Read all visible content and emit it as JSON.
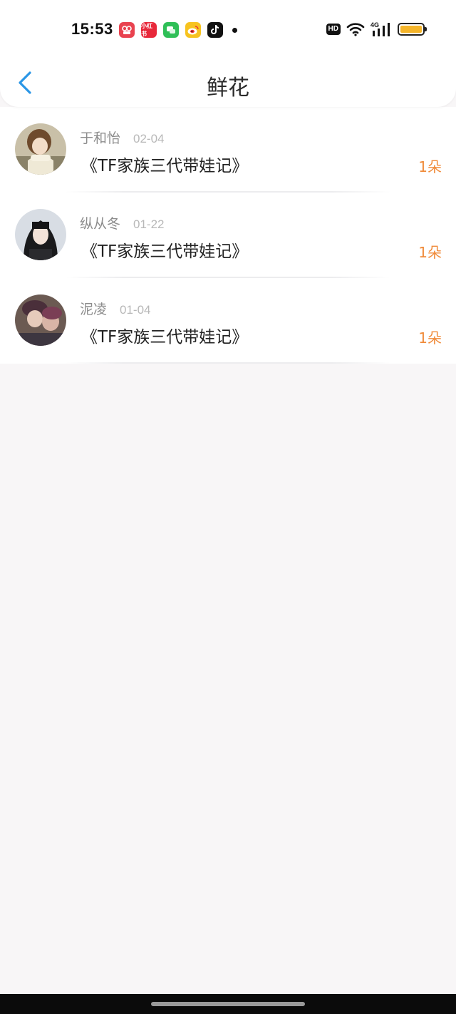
{
  "status_bar": {
    "time": "15:53",
    "notification_icons": [
      {
        "name": "app-icon-red-camera",
        "color": "#e9424f",
        "label": ""
      },
      {
        "name": "app-icon-xiaohongshu",
        "color": "#e8283a",
        "label": "小红书"
      },
      {
        "name": "app-icon-wechat-green",
        "color": "#2fbf57",
        "label": ""
      },
      {
        "name": "app-icon-weibo",
        "color": "#f7c31f",
        "label": ""
      },
      {
        "name": "app-icon-tiktok",
        "color": "#111111",
        "label": ""
      }
    ],
    "hd_label": "HD",
    "network": "4G"
  },
  "header": {
    "title": "鲜花",
    "back_icon": "chevron-left-icon",
    "accent_color": "#2a96e6"
  },
  "list": {
    "items": [
      {
        "user": "于和怡",
        "date": "02-04",
        "book_title": "《TF家族三代带娃记》",
        "count": "1朵"
      },
      {
        "user": "纵从冬",
        "date": "01-22",
        "book_title": "《TF家族三代带娃记》",
        "count": "1朵"
      },
      {
        "user": "泥凌",
        "date": "01-04",
        "book_title": "《TF家族三代带娃记》",
        "count": "1朵"
      }
    ],
    "count_color": "#f08b3a"
  }
}
